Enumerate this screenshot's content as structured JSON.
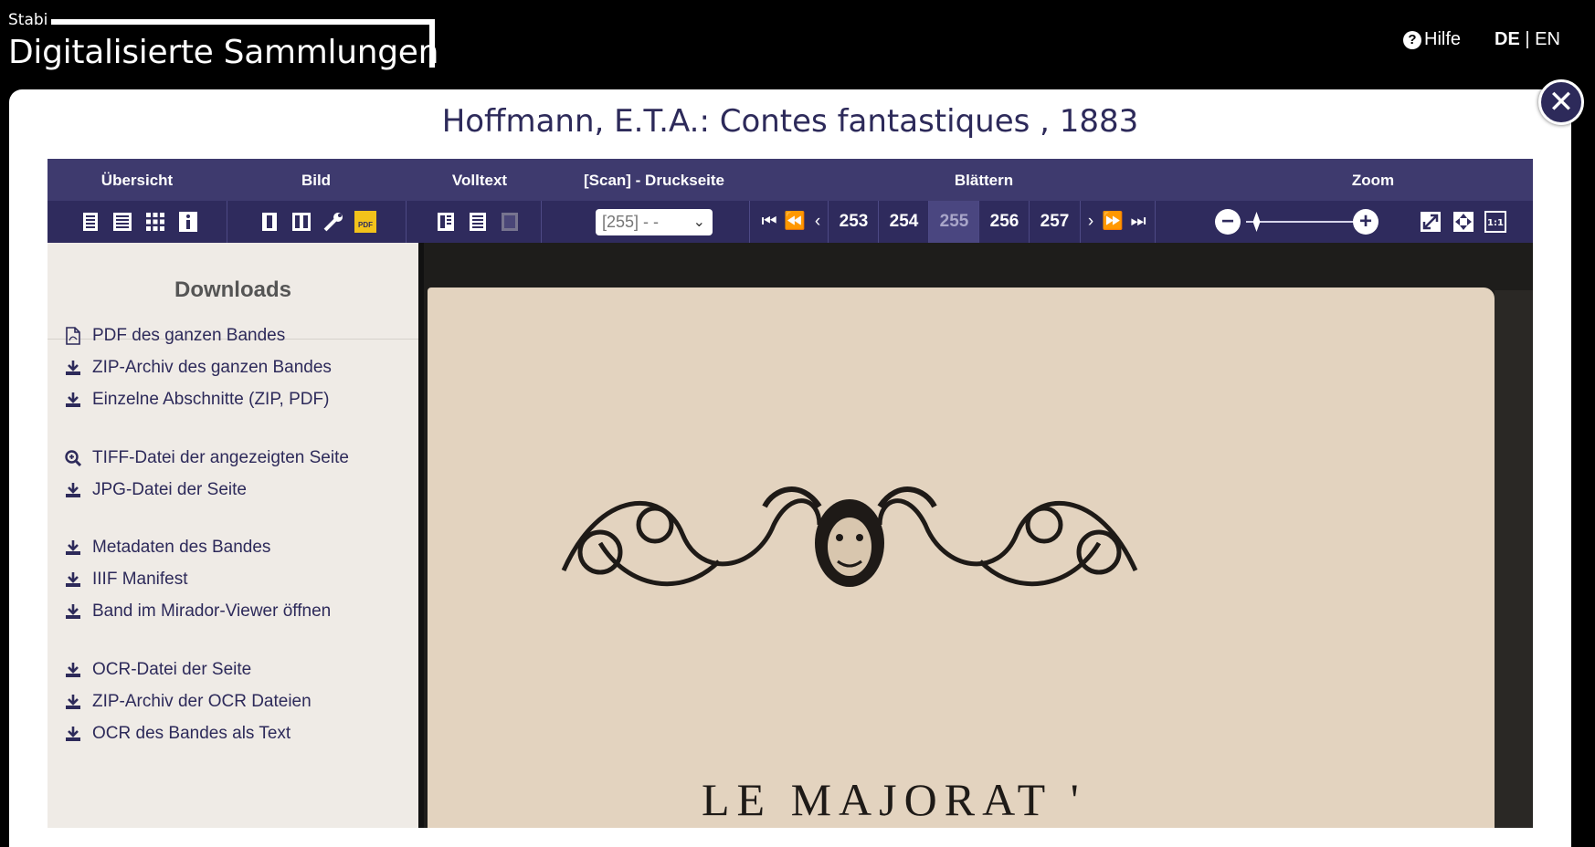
{
  "header": {
    "logo_small": "Stabi",
    "logo_big": "Digitalisierte Sammlungen",
    "help_icon": "?",
    "help_label": "Hilfe",
    "lang_de": "DE",
    "lang_sep": "|",
    "lang_en": "EN"
  },
  "document": {
    "title": "Hoffmann, E.T.A.: Contes fantastiques , 1883",
    "close_icon": "close-icon"
  },
  "toolbar": {
    "labels": {
      "overview": "Übersicht",
      "image": "Bild",
      "fulltext": "Volltext",
      "scan": "[Scan] - Druckseite",
      "browse": "Blättern",
      "zoom": "Zoom"
    },
    "scan_select_value": "[255] - -",
    "pages": [
      "253",
      "254",
      "255",
      "256",
      "257"
    ],
    "current_page": "255",
    "icons": {
      "overview": [
        "page-icon",
        "list-icon",
        "grid-icon",
        "info-icon"
      ],
      "image": [
        "single-page-icon",
        "double-page-icon",
        "tools-icon",
        "pdf-icon"
      ],
      "fulltext": [
        "split-view-icon",
        "text-icon",
        "image-view-icon"
      ],
      "zoom": [
        "zoom-out-icon",
        "zoom-in-icon",
        "fullscreen-icon",
        "fit-icon",
        "actual-size-icon"
      ]
    },
    "zoom_level": 0.25,
    "pdf_label": "PDF"
  },
  "downloads": {
    "heading": "Downloads",
    "groups": [
      [
        {
          "label": "PDF des ganzen Bandes",
          "icon": "pdf-file-icon"
        },
        {
          "label": "ZIP-Archiv des ganzen Bandes",
          "icon": "download-icon"
        },
        {
          "label": "Einzelne Abschnitte (ZIP, PDF)",
          "icon": "download-icon"
        }
      ],
      [
        {
          "label": "TIFF-Datei der angezeigten Seite",
          "icon": "zoom-search-icon"
        },
        {
          "label": "JPG-Datei der Seite",
          "icon": "download-icon"
        }
      ],
      [
        {
          "label": "Metadaten des Bandes",
          "icon": "download-icon"
        },
        {
          "label": "IIIF Manifest",
          "icon": "download-icon"
        },
        {
          "label": "Band im Mirador-Viewer öffnen",
          "icon": "download-icon"
        }
      ],
      [
        {
          "label": "OCR-Datei der Seite",
          "icon": "download-icon"
        },
        {
          "label": "ZIP-Archiv der OCR Dateien",
          "icon": "download-icon"
        },
        {
          "label": "OCR des Bandes als Text",
          "icon": "download-icon"
        }
      ]
    ]
  },
  "viewer": {
    "page_text": "LE MAJORAT '",
    "ornament_icon": "ornament-icon"
  },
  "colors": {
    "primary": "#2d2a5a",
    "toolbar_top": "#3e3a6e",
    "toolbar_bottom": "#2f2b5d",
    "sidebar_bg": "#efebe6",
    "page_paper": "#e3d3bf",
    "pdf_badge": "#f2c21b"
  }
}
